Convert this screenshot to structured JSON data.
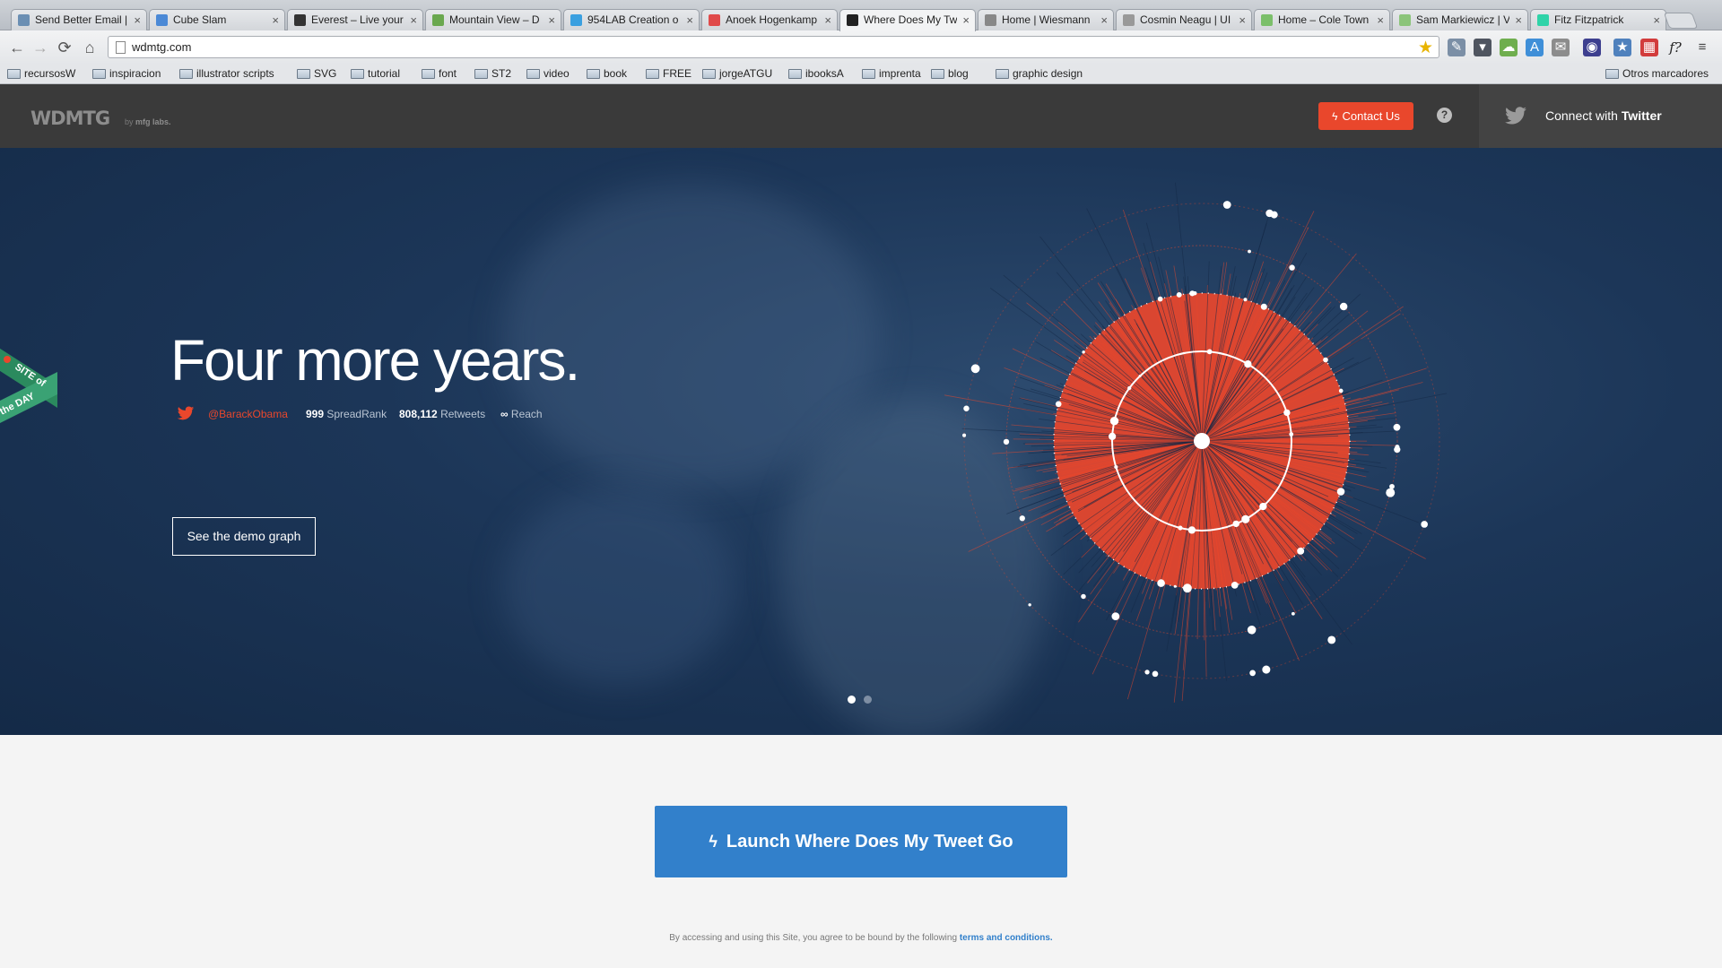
{
  "browser": {
    "tabs": [
      {
        "title": "Send Better Email |",
        "favicon_color": "#6b8fb3"
      },
      {
        "title": "Cube Slam",
        "favicon_color": "#4b89d6"
      },
      {
        "title": "Everest – Live your",
        "favicon_color": "#333333"
      },
      {
        "title": "Mountain View – D",
        "favicon_color": "#6aa84f"
      },
      {
        "title": "954LAB Creation o",
        "favicon_color": "#3aa0e0"
      },
      {
        "title": "Anoek Hogenkamp",
        "favicon_color": "#e04a4a"
      },
      {
        "title": "Where Does My Tw",
        "favicon_color": "#222222"
      },
      {
        "title": "Home | Wiesmann",
        "favicon_color": "#888888"
      },
      {
        "title": "Cosmin Neagu | UI",
        "favicon_color": "#999999"
      },
      {
        "title": "Home – Cole Town",
        "favicon_color": "#7bbf6a"
      },
      {
        "title": "Sam Markiewicz | V",
        "favicon_color": "#8bc47a"
      },
      {
        "title": "Fitz Fitzpatrick",
        "favicon_color": "#2fd3a8"
      }
    ],
    "active_tab_index": 6,
    "url": "wdmtg.com",
    "bookmarks": [
      "recursosW",
      "inspiracion",
      "illustrator scripts",
      "SVG",
      "tutorial",
      "font",
      "ST2",
      "video",
      "book",
      "FREE",
      "jorgeATGU",
      "ibooksA",
      "imprenta",
      "blog",
      "graphic design"
    ],
    "other_bookmarks": "Otros marcadores"
  },
  "header": {
    "logo": "WDMTG",
    "byline_prefix": "by",
    "byline_brand": "mfg labs.",
    "contact_label": "Contact Us",
    "help_label": "?",
    "twitter_prefix": "Connect with",
    "twitter_brand": "Twitter"
  },
  "hero": {
    "title": "Four more years.",
    "handle": "@BarackObama",
    "spreadrank_value": "999",
    "spreadrank_label": "SpreadRank",
    "retweets_value": "808,112",
    "retweets_label": "Retweets",
    "reach_value": "∞",
    "reach_label": "Reach",
    "demo_button": "See the demo graph",
    "badge_line1": "SITE of",
    "badge_line2": "the DAY",
    "slides": 2,
    "active_slide": 0
  },
  "main": {
    "launch_label": "Launch Where Does My Tweet Go",
    "legal_text": "By accessing and using this Site, you agree to be bound by the following",
    "legal_link": "terms and conditions."
  },
  "colors": {
    "accent": "#e9472c",
    "hero_bg": "#1c3658",
    "launch_blue": "#3280cb",
    "header_bg": "#3a3a3a"
  }
}
